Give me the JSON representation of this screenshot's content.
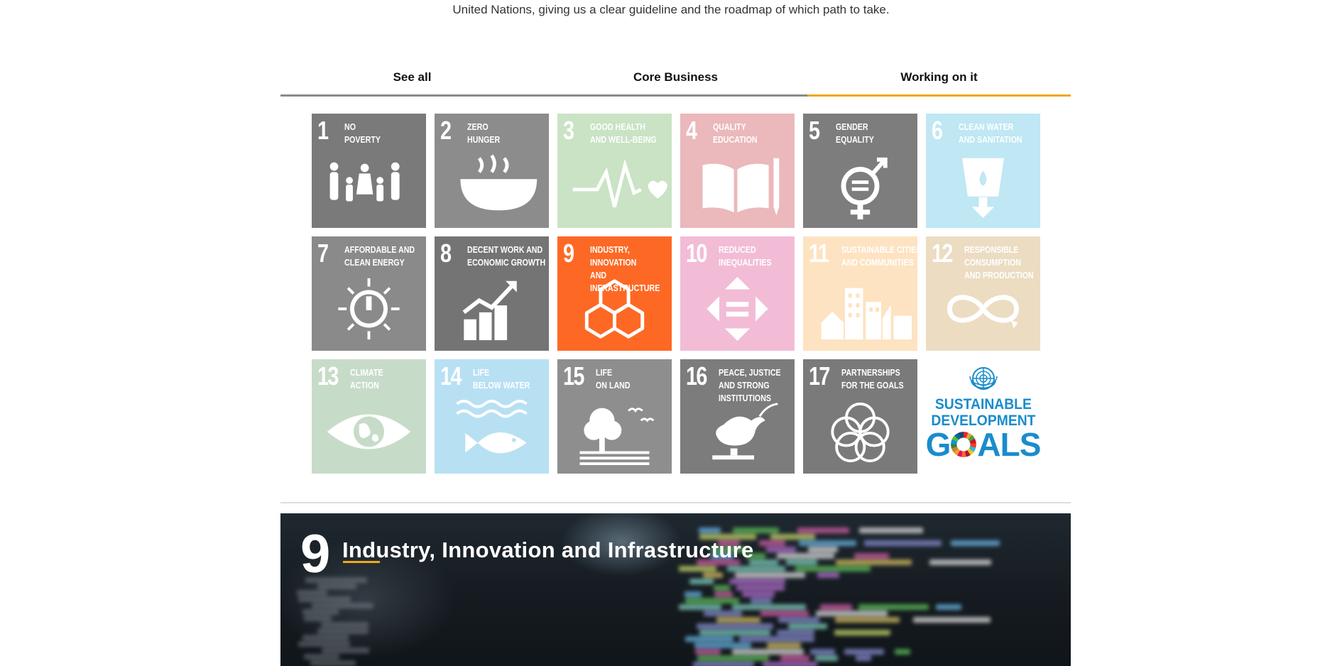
{
  "intro_text": "United Nations, giving us a clear guideline and the roadmap of which path to take.",
  "tabs": [
    {
      "label": "See all",
      "active": false
    },
    {
      "label": "Core Business",
      "active": false
    },
    {
      "label": "Working on it",
      "active": true
    }
  ],
  "goals": [
    {
      "number": "1",
      "name": "NO\nPOVERTY",
      "color": "#7a7a7a",
      "icon": "family-icon"
    },
    {
      "number": "2",
      "name": "ZERO\nHUNGER",
      "color": "#8c8c8c",
      "icon": "bowl-icon"
    },
    {
      "number": "3",
      "name": "GOOD HEALTH\nAND WELL-BEING",
      "color": "#c9e3c4",
      "icon": "heartbeat-icon"
    },
    {
      "number": "4",
      "name": "QUALITY\nEDUCATION",
      "color": "#ebb8bc",
      "icon": "book-pencil-icon"
    },
    {
      "number": "5",
      "name": "GENDER\nEQUALITY",
      "color": "#7d7d7d",
      "icon": "gender-equality-icon"
    },
    {
      "number": "6",
      "name": "CLEAN WATER\nAND SANITATION",
      "color": "#bfe7f4",
      "icon": "water-glass-icon"
    },
    {
      "number": "7",
      "name": "AFFORDABLE AND\nCLEAN ENERGY",
      "color": "#8a8a8a",
      "icon": "sun-power-icon"
    },
    {
      "number": "8",
      "name": "DECENT WORK AND\nECONOMIC GROWTH",
      "color": "#747474",
      "icon": "growth-chart-icon"
    },
    {
      "number": "9",
      "name": "INDUSTRY, INNOVATION\nAND INFRASTRUCTURE",
      "color": "#fd6925",
      "icon": "cubes-icon"
    },
    {
      "number": "10",
      "name": "REDUCED\nINEQUALITIES",
      "color": "#f2bcd6",
      "icon": "arrows-equal-icon"
    },
    {
      "number": "11",
      "name": "SUSTAINABLE CITIES\nAND COMMUNITIES",
      "color": "#fde3c1",
      "icon": "city-buildings-icon"
    },
    {
      "number": "12",
      "name": "RESPONSIBLE\nCONSUMPTION\nAND PRODUCTION",
      "color": "#ecdcc2",
      "icon": "infinity-icon"
    },
    {
      "number": "13",
      "name": "CLIMATE\nACTION",
      "color": "#c7dcc8",
      "icon": "eye-globe-icon"
    },
    {
      "number": "14",
      "name": "LIFE\nBELOW WATER",
      "color": "#b8e0f3",
      "icon": "fish-waves-icon"
    },
    {
      "number": "15",
      "name": "LIFE\nON LAND",
      "color": "#8e8e8e",
      "icon": "tree-birds-icon"
    },
    {
      "number": "16",
      "name": "PEACE, JUSTICE\nAND STRONG\nINSTITUTIONS",
      "color": "#7c7c7c",
      "icon": "dove-gavel-icon"
    },
    {
      "number": "17",
      "name": "PARTNERSHIPS\nFOR THE GOALS",
      "color": "#7a7a7a",
      "icon": "rings-icon"
    }
  ],
  "sdg_logo": {
    "line1": "SUSTAINABLE",
    "line2": "DEVELOPMENT",
    "goals_g": "G",
    "goals_rest": "ALS",
    "color": "#1a8ccc",
    "icon": "un-emblem-icon"
  },
  "hero": {
    "number": "9",
    "title": "Industry, Innovation and Infrastructure",
    "accent_color": "#f0a81c"
  }
}
